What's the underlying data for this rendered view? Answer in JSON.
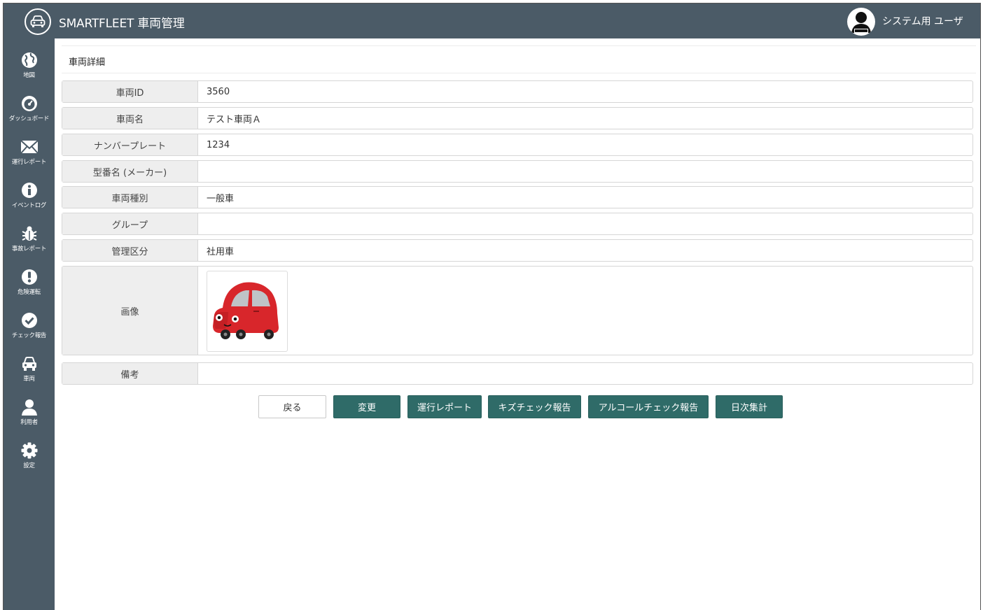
{
  "header": {
    "app_title": "SMARTFLEET 車両管理",
    "user_name": "システム用 ユーザ"
  },
  "sidebar": {
    "items": [
      {
        "label": "地図",
        "icon": "globe-icon"
      },
      {
        "label": "ダッシュボード",
        "icon": "speedometer-icon"
      },
      {
        "label": "運行レポート",
        "icon": "envelope-icon"
      },
      {
        "label": "イベントログ",
        "icon": "info-icon"
      },
      {
        "label": "事故レポート",
        "icon": "bug-icon"
      },
      {
        "label": "危険運転",
        "icon": "exclamation-icon"
      },
      {
        "label": "チェック報告",
        "icon": "check-circle-icon"
      },
      {
        "label": "車両",
        "icon": "car-icon"
      },
      {
        "label": "利用者",
        "icon": "user-icon"
      },
      {
        "label": "設定",
        "icon": "gear-icon"
      }
    ]
  },
  "page": {
    "title": "車両詳細"
  },
  "fields": [
    {
      "label": "車両ID",
      "value": "3560"
    },
    {
      "label": "車両名",
      "value": "テスト車両Ａ"
    },
    {
      "label": "ナンバープレート",
      "value": "1234"
    },
    {
      "label": "型番名 (メーカー)",
      "value": ""
    },
    {
      "label": "車両種別",
      "value": "一般車"
    },
    {
      "label": "グループ",
      "value": ""
    },
    {
      "label": "管理区分",
      "value": "社用車"
    },
    {
      "label": "画像",
      "value": ""
    },
    {
      "label": "備考",
      "value": ""
    }
  ],
  "actions": {
    "back": "戻る",
    "edit": "変更",
    "trip_report": "運行レポート",
    "damage_check": "キズチェック報告",
    "alcohol_check": "アルコールチェック報告",
    "daily_summary": "日次集計"
  },
  "colors": {
    "chrome": "#4b5b67",
    "button_primary": "#2f6b68",
    "car_body": "#d8262b"
  }
}
